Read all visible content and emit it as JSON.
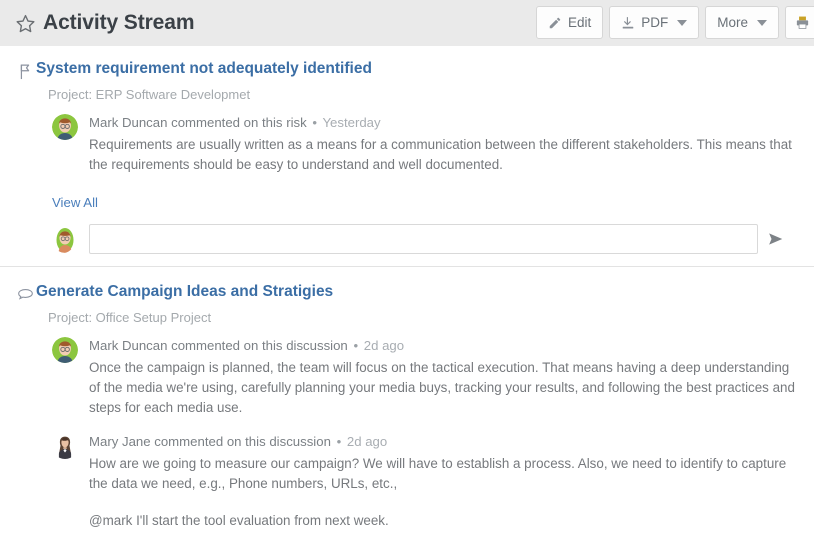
{
  "header": {
    "title": "Activity Stream",
    "star_icon": "star-outline-icon",
    "toolbar": {
      "edit_label": "Edit",
      "edit_icon": "pencil-icon",
      "pdf_label": "PDF",
      "pdf_icon": "download-icon",
      "more_label": "More",
      "print_icon": "printer-icon"
    }
  },
  "activities": [
    {
      "icon": "flag-risk-icon",
      "title": "System requirement not adequately identified",
      "project": "Project: ERP Software Developmet",
      "comments": [
        {
          "avatar": "avatar-mark-duncan",
          "author": "Mark Duncan",
          "action": "commented on this risk",
          "separator": "•",
          "time": "Yesterday",
          "paragraphs": [
            "Requirements are usually written as a means for a communication between the different stakeholders. This means that the requirements should be easy to understand and well documented."
          ]
        }
      ],
      "view_all_label": "View All",
      "reply": {
        "avatar": "avatar-current-user",
        "value": "",
        "placeholder": "",
        "send_icon": "send-arrow-icon"
      }
    },
    {
      "icon": "discussion-bubble-icon",
      "title": "Generate Campaign Ideas and Stratigies",
      "project": "Project: Office Setup Project",
      "comments": [
        {
          "avatar": "avatar-mark-duncan",
          "author": "Mark Duncan",
          "action": "commented on this discussion",
          "separator": "•",
          "time": "2d ago",
          "paragraphs": [
            "Once the campaign is planned, the team will focus on the tactical execution. That means having a deep understanding of the media we're using, carefully planning your media buys, tracking your results, and following the best practices and steps for each media use."
          ]
        },
        {
          "avatar": "avatar-mary-jane",
          "author": "Mary Jane",
          "action": "commented on this discussion",
          "separator": "•",
          "time": "2d ago",
          "paragraphs": [
            "How are we going to measure our campaign? We will have to establish a process. Also, we need to identify to capture the data we need, e.g., Phone numbers, URLs, etc.,",
            "@mark I'll start the tool evaluation from next week."
          ]
        }
      ]
    }
  ],
  "colors": {
    "header_bg": "#eaeaea",
    "title_text": "#3b4147",
    "link_blue": "#3b6ea5",
    "body_text": "#76797d",
    "muted_text": "#a4a9ad"
  }
}
